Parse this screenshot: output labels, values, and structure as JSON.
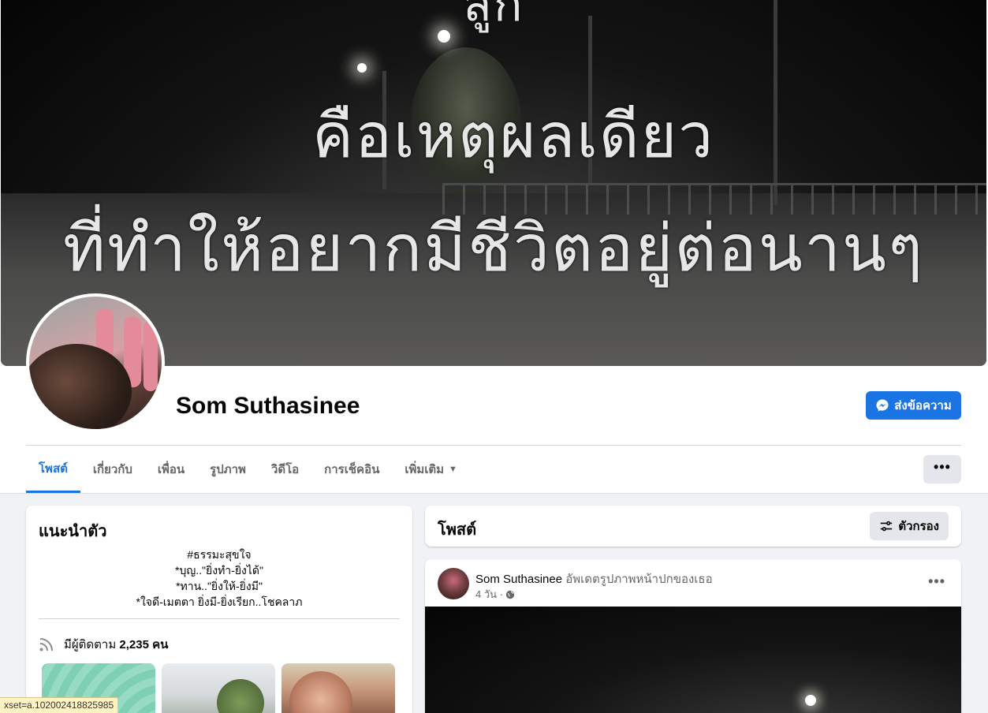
{
  "cover": {
    "line1": "สูก",
    "line2": "คือเหตุผลเดียว",
    "line3": "ที่ทำให้อยากมีชีวิตอยู่ต่อนานๆ"
  },
  "profile": {
    "name": "Som Suthasinee",
    "message_button": "ส่งข้อความ"
  },
  "tabs": [
    {
      "label": "โพสต์"
    },
    {
      "label": "เกี่ยวกับ"
    },
    {
      "label": "เพื่อน"
    },
    {
      "label": "รูปภาพ"
    },
    {
      "label": "วิดีโอ"
    },
    {
      "label": "การเช็คอิน"
    },
    {
      "label": "เพิ่มเติม"
    }
  ],
  "more_options": "•••",
  "intro": {
    "title": "แนะนำตัว",
    "bio": [
      "#ธรรมะสุขใจ",
      "*บุญ..\"ยิ่งทำ-ยิ่งได้\"",
      "*ทาน..\"ยิ่งให้-ยิ่งมี\"",
      "*ใจดี-เมตตา ยิ่งมี-ยิ่งเรียก..โชคลาภ"
    ],
    "followers_prefix": "มีผู้ติดตาม",
    "followers_count": "2,235 คน"
  },
  "posts": {
    "title": "โพสต์",
    "filter_label": "ตัวกรอง"
  },
  "post": {
    "author": "Som Suthasinee",
    "action": "อัพเดตรูปภาพหน้าปกของเธอ",
    "time": "4 วัน ·"
  },
  "status_url": "xset=a.102002418825985"
}
